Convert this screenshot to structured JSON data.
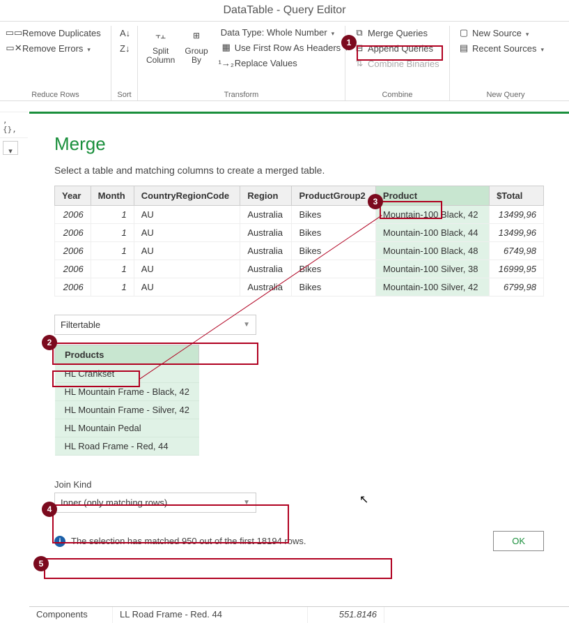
{
  "window_title": "DataTable - Query Editor",
  "ribbon": {
    "remove_duplicates": "Remove Duplicates",
    "remove_errors": "Remove Errors",
    "reduce_rows": "Reduce Rows",
    "sort": "Sort",
    "split_column": "Split\nColumn",
    "group_by": "Group\nBy",
    "data_type": "Data Type: Whole Number",
    "first_row_headers": "Use First Row As Headers",
    "replace_values": "Replace Values",
    "transform": "Transform",
    "merge_queries": "Merge Queries",
    "append_queries": "Append Queries",
    "combine_binaries": "Combine Binaries",
    "combine": "Combine",
    "new_source": "New Source",
    "recent_sources": "Recent Sources",
    "new_query": "New Query"
  },
  "left_values": [
    ", {},"
  ],
  "dialog": {
    "title": "Merge",
    "subtitle": "Select a table and matching columns to create a merged table.",
    "table1": {
      "headers": [
        "Year",
        "Month",
        "CountryRegionCode",
        "Region",
        "ProductGroup2",
        "Product",
        "$Total"
      ],
      "rows": [
        [
          "2006",
          "1",
          "AU",
          "Australia",
          "Bikes",
          "Mountain-100 Black, 42",
          "13499,96"
        ],
        [
          "2006",
          "1",
          "AU",
          "Australia",
          "Bikes",
          "Mountain-100 Black, 44",
          "13499,96"
        ],
        [
          "2006",
          "1",
          "AU",
          "Australia",
          "Bikes",
          "Mountain-100 Black, 48",
          "6749,98"
        ],
        [
          "2006",
          "1",
          "AU",
          "Australia",
          "Bikes",
          "Mountain-100 Silver, 38",
          "16999,95"
        ],
        [
          "2006",
          "1",
          "AU",
          "Australia",
          "Bikes",
          "Mountain-100 Silver, 42",
          "6799,98"
        ]
      ]
    },
    "filter_table_dropdown": "Filtertable",
    "table2": {
      "header": "Products",
      "rows": [
        "HL Crankset",
        "HL Mountain Frame - Black, 42",
        "HL Mountain Frame - Silver, 42",
        "HL Mountain Pedal",
        "HL Road Frame - Red, 44"
      ]
    },
    "join_kind_label": "Join Kind",
    "join_kind_value": "Inner (only matching rows)",
    "match_info": "The selection has matched 950 out of the first 18194 rows.",
    "ok": "OK"
  },
  "footer": {
    "c1": "Components",
    "c2": "LL Road Frame - Red. 44",
    "c3": "551.8146"
  }
}
